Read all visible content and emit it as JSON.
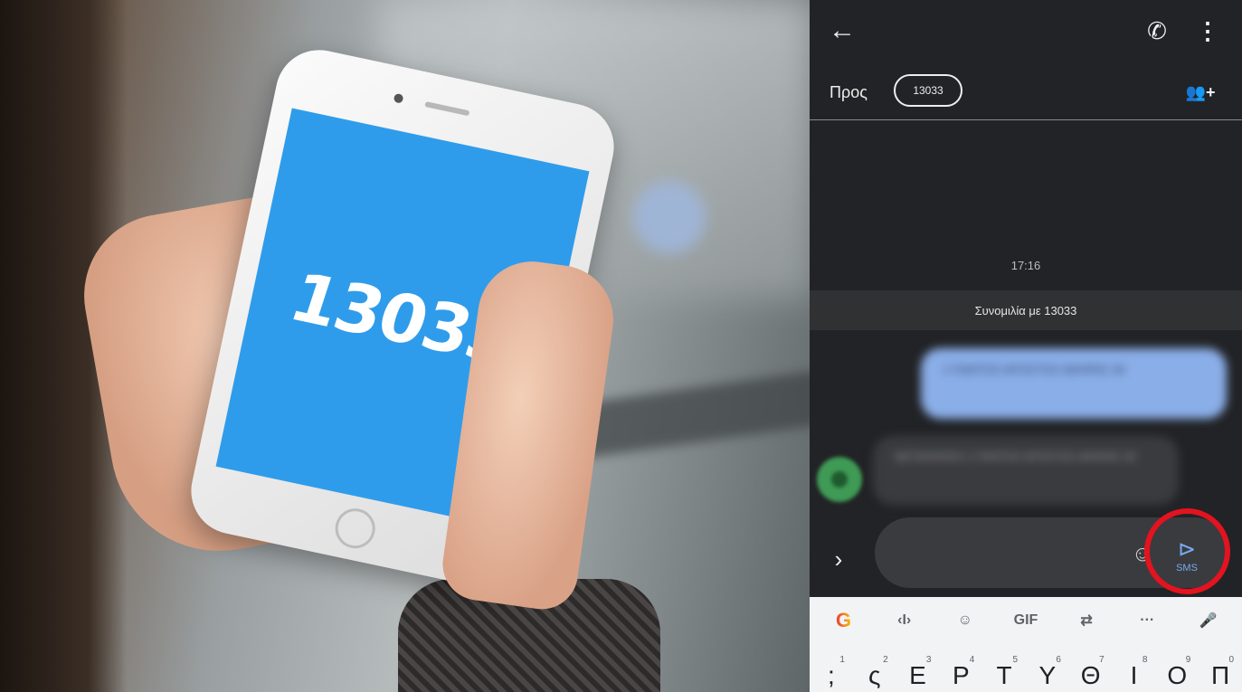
{
  "photo": {
    "phone_screen_text": "13033",
    "colors": {
      "screen_blue": "#2f9ceb"
    }
  },
  "app": {
    "header": {
      "back_icon": "←",
      "call_icon": "✆",
      "more_icon": "⋮"
    },
    "to_row": {
      "label": "Προς",
      "recipient": "13033",
      "add_contact_icon": "👥+"
    },
    "timestamp": "17:16",
    "conversation_banner": "Συνομιλία με 13033",
    "sent_message": "1 ΠΑΝΤΟΣ ΑΡΟΣΤΟΣ ΑΦΗΡΑΣ 30",
    "received_message": "ΜΕΤΑΚΙΝΗΣΗ 1 ΠΑΝΤΟΣ ΑΡΟΣΤΟΣ ΑΦΗΡΑΣ 30",
    "composer": {
      "expand_icon": "›",
      "emoji_icon": "☺",
      "send_icon": "⊳",
      "send_label": "SMS"
    },
    "highlight_color": "#e3131f",
    "keyboard": {
      "tools": [
        "G",
        "‹I›",
        "☺",
        "GIF",
        "⇄",
        "···",
        "🎤"
      ],
      "keys": [
        {
          "char": ";",
          "hint": "1"
        },
        {
          "char": "ς",
          "hint": "2"
        },
        {
          "char": "Ε",
          "hint": "3"
        },
        {
          "char": "Ρ",
          "hint": "4"
        },
        {
          "char": "Τ",
          "hint": "5"
        },
        {
          "char": "Υ",
          "hint": "6"
        },
        {
          "char": "Θ",
          "hint": "7"
        },
        {
          "char": "Ι",
          "hint": "8"
        },
        {
          "char": "Ο",
          "hint": "9"
        },
        {
          "char": "Π",
          "hint": "0"
        }
      ]
    }
  }
}
